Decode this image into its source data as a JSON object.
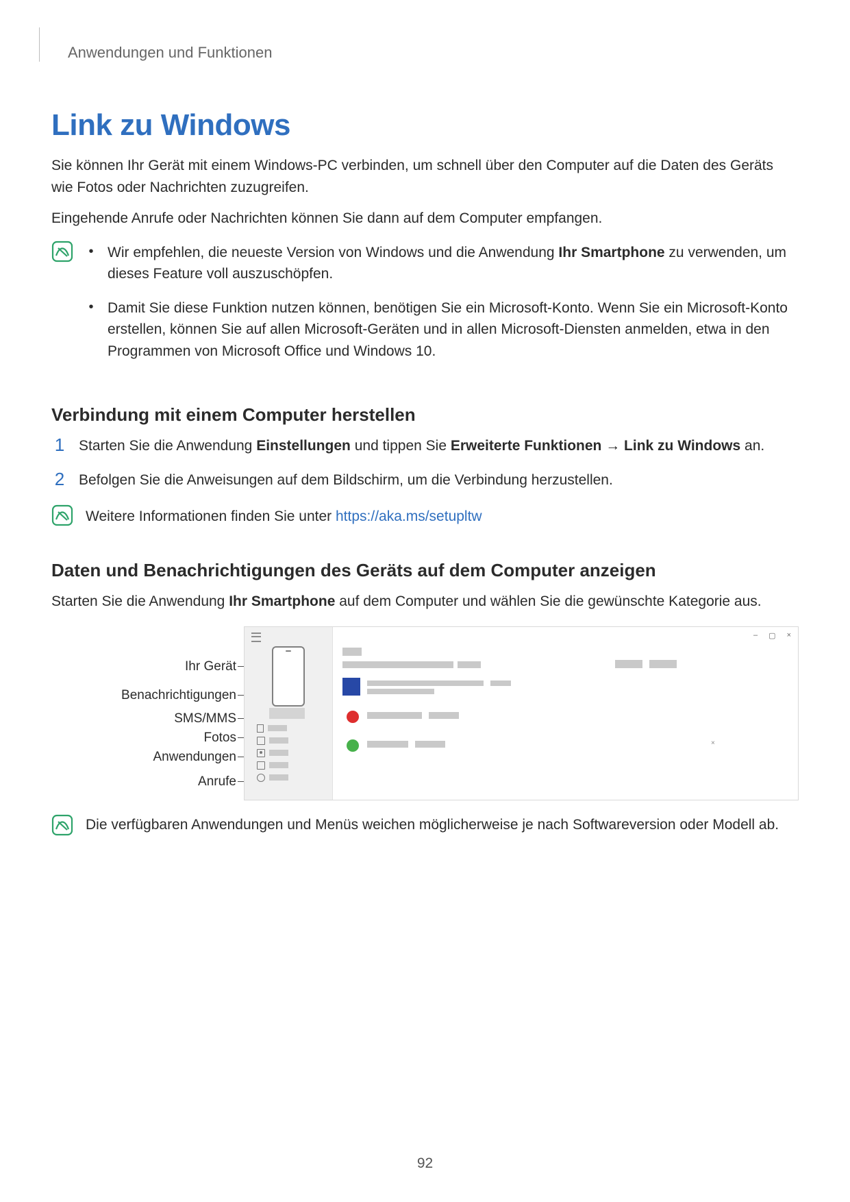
{
  "header": {
    "breadcrumb": "Anwendungen und Funktionen"
  },
  "title": "Link zu Windows",
  "intro_p1": "Sie können Ihr Gerät mit einem Windows-PC verbinden, um schnell über den Computer auf die Daten des Geräts wie Fotos oder Nachrichten zuzugreifen.",
  "intro_p2": "Eingehende Anrufe oder Nachrichten können Sie dann auf dem Computer empfangen.",
  "note1": {
    "bullet1": {
      "pre": "Wir empfehlen, die neueste Version von Windows und die Anwendung ",
      "bold": "Ihr Smartphone",
      "post": " zu verwenden, um dieses Feature voll auszuschöpfen."
    },
    "bullet2": "Damit Sie diese Funktion nutzen können, benötigen Sie ein Microsoft-Konto. Wenn Sie ein Microsoft-Konto erstellen, können Sie auf allen Microsoft-Geräten und in allen Microsoft-Diensten anmelden, etwa in den Programmen von Microsoft Office und Windows 10."
  },
  "section1": {
    "heading": "Verbindung mit einem Computer herstellen",
    "step1": {
      "pre": "Starten Sie die Anwendung ",
      "b1": "Einstellungen",
      "mid1": " und tippen Sie ",
      "b2": "Erweiterte Funktionen",
      "arrow": " → ",
      "b3": "Link zu Windows",
      "post": " an."
    },
    "step2": "Befolgen Sie die Anweisungen auf dem Bildschirm, um die Verbindung herzustellen.",
    "note": {
      "pre": "Weitere Informationen finden Sie unter ",
      "link": "https://aka.ms/setupltw"
    }
  },
  "section2": {
    "heading": "Daten und Benachrichtigungen des Geräts auf dem Computer anzeigen",
    "p": {
      "pre": "Starten Sie die Anwendung ",
      "bold": "Ihr Smartphone",
      "post": " auf dem Computer und wählen Sie die gewünschte Kategorie aus."
    }
  },
  "diagram": {
    "labels": {
      "device": "Ihr Gerät",
      "notifications": "Benachrichtigungen",
      "sms": "SMS/MMS",
      "photos": "Fotos",
      "apps": "Anwendungen",
      "calls": "Anrufe"
    }
  },
  "note_final": "Die verfügbaren Anwendungen und Menüs weichen möglicherweise je nach Softwareversion oder Modell ab.",
  "page_number": "92"
}
